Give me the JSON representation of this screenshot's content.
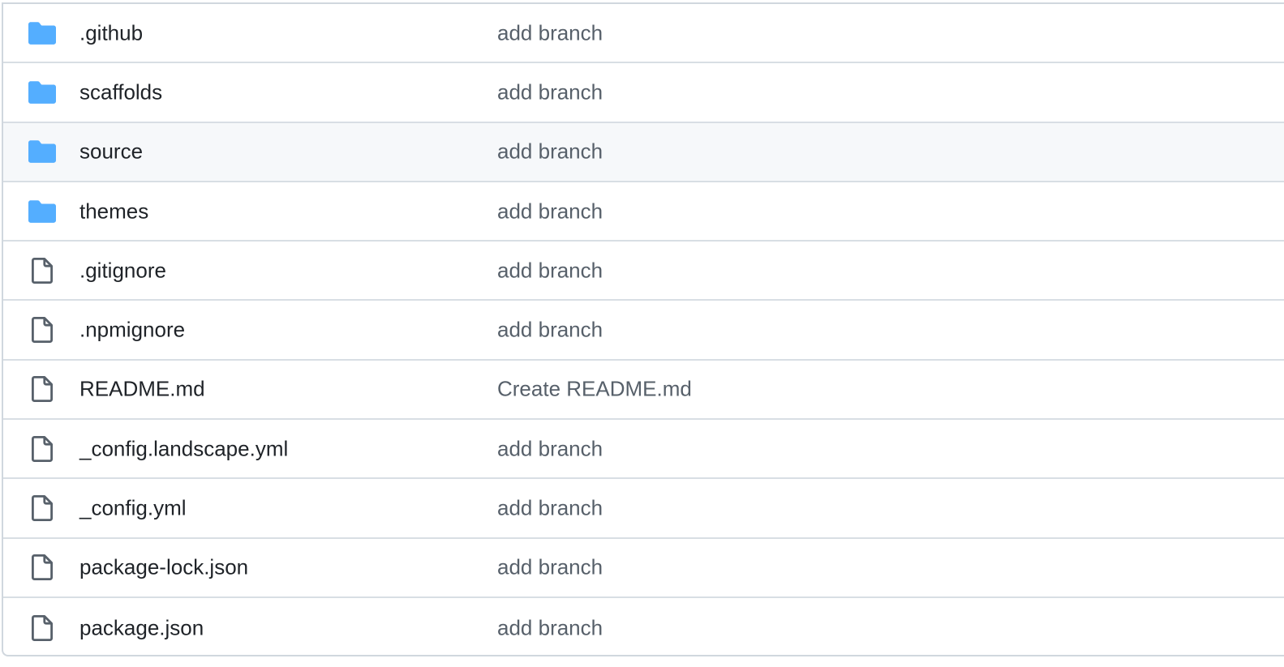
{
  "colors": {
    "folder": "#54aeff",
    "file_icon": "#57606a",
    "name_text": "#1f2328",
    "commit_text": "#57606a",
    "border": "#d0d7de",
    "hover_row": "#f6f8fa"
  },
  "files": [
    {
      "name": ".github",
      "type": "folder",
      "icon": "folder-icon",
      "commit": "add branch"
    },
    {
      "name": "scaffolds",
      "type": "folder",
      "icon": "folder-icon",
      "commit": "add branch"
    },
    {
      "name": "source",
      "type": "folder",
      "icon": "folder-icon",
      "commit": "add branch",
      "hovered": true
    },
    {
      "name": "themes",
      "type": "folder",
      "icon": "folder-icon",
      "commit": "add branch"
    },
    {
      "name": ".gitignore",
      "type": "file",
      "icon": "file-icon",
      "commit": "add branch"
    },
    {
      "name": ".npmignore",
      "type": "file",
      "icon": "file-icon",
      "commit": "add branch"
    },
    {
      "name": "README.md",
      "type": "file",
      "icon": "file-icon",
      "commit": "Create README.md"
    },
    {
      "name": "_config.landscape.yml",
      "type": "file",
      "icon": "file-icon",
      "commit": "add branch"
    },
    {
      "name": "_config.yml",
      "type": "file",
      "icon": "file-icon",
      "commit": "add branch"
    },
    {
      "name": "package-lock.json",
      "type": "file",
      "icon": "file-icon",
      "commit": "add branch"
    },
    {
      "name": "package.json",
      "type": "file",
      "icon": "file-icon",
      "commit": "add branch"
    }
  ]
}
